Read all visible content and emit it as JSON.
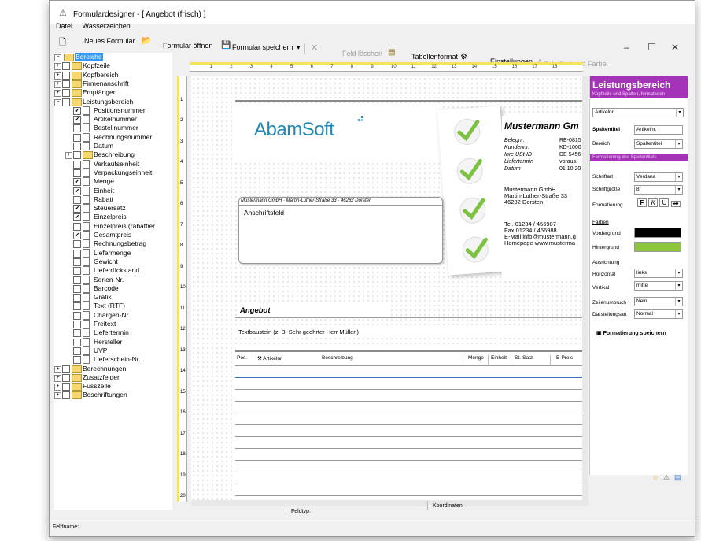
{
  "window": {
    "title": "Formulardesigner - [ Angebot (frisch) ]",
    "menu": [
      "Datei",
      "Wasserzeichen"
    ]
  },
  "toolbar": {
    "new_form": "Neues Formular",
    "open_form": "Formular öffnen",
    "save_form": "Formular speichern",
    "delete_field": "Feld löschen",
    "table_format": "Tabellenformat",
    "settings": "Einstellungen",
    "font_color": "Schriftart und Farbe"
  },
  "tree": {
    "root": "Bereiche",
    "top": [
      "Kopfzeile",
      "Kopfbereich",
      "Firmenanschrift",
      "Empfänger",
      "Leistungsbereich"
    ],
    "leistung": [
      {
        "label": "Positionsnummer",
        "checked": true
      },
      {
        "label": "Artikelnummer",
        "checked": true
      },
      {
        "label": "Bestellnummer",
        "checked": false
      },
      {
        "label": "Rechnungsnummer",
        "checked": false
      },
      {
        "label": "Datum",
        "checked": false
      },
      {
        "label": "Beschreibung",
        "checked": false
      },
      {
        "label": "Verkaufseinheit",
        "checked": false
      },
      {
        "label": "Verpackungseinheit",
        "checked": false
      },
      {
        "label": "Menge",
        "checked": true
      },
      {
        "label": "Einheit",
        "checked": true
      },
      {
        "label": "Rabatt",
        "checked": false
      },
      {
        "label": "Steuersatz",
        "checked": true
      },
      {
        "label": "Einzelpreis",
        "checked": true
      },
      {
        "label": "Einzelpreis (rabattier",
        "checked": false
      },
      {
        "label": "Gesamtpreis",
        "checked": true
      },
      {
        "label": "Rechnungsbetrag",
        "checked": false
      },
      {
        "label": "Liefermenge",
        "checked": false
      },
      {
        "label": "Gewicht",
        "checked": false
      },
      {
        "label": "Lieferrückstand",
        "checked": false
      },
      {
        "label": "Serien-Nr.",
        "checked": false
      },
      {
        "label": "Barcode",
        "checked": false
      },
      {
        "label": "Grafik",
        "checked": false
      },
      {
        "label": "Text (RTF)",
        "checked": false
      },
      {
        "label": "Chargen-Nr.",
        "checked": false
      },
      {
        "label": "Freitext",
        "checked": false
      },
      {
        "label": "Liefertermin",
        "checked": false
      },
      {
        "label": "Hersteller",
        "checked": false
      },
      {
        "label": "UVP",
        "checked": false
      },
      {
        "label": "Lieferschein-Nr.",
        "checked": false
      }
    ],
    "bottom": [
      "Berechnungen",
      "Zusatzfelder",
      "Fusszeile",
      "Beschriftungen"
    ]
  },
  "doc": {
    "logo": "AbamSoft",
    "company": "Mustermann Gm",
    "sender_line": "Mustermann GmbH · Martin-Luther-Straße 33 · 46282 Dorsten",
    "address_field": "Anschriftsfeld",
    "info_labels": [
      "Belegnr.",
      "Kundennr.",
      "Ihre USt-ID",
      "Liefertermin",
      "Datum"
    ],
    "info_values": [
      "RE-0815",
      "KD-1000",
      "DE 5456",
      "voraus.",
      "01.10.20"
    ],
    "company_address": [
      "Mustermann GmbH",
      "Martin-Luther-Straße 33",
      "46282 Dorsten"
    ],
    "contacts": [
      "Tel. 01234 / 456987",
      "Fax 01234 / 456988",
      "E-Mail info@mustermann.g",
      "Homepage www.musterma"
    ],
    "heading": "Angebot",
    "textbaustein": "Textbaustein (z. B. Sehr geehrter Herr Müller,)",
    "columns": [
      "Pos.",
      "Artikelnr.",
      "Beschreibung",
      "Menge",
      "Einheit",
      "St.-Satz",
      "E-Preis"
    ]
  },
  "panel": {
    "title": "Leistungsbereich",
    "subtitle": "Kopfzeile und Spalten, formatieren",
    "field_select": "Artikelnr.",
    "spaltentitel_label": "Spaltentitel",
    "spaltentitel_value": "Artikelnr.",
    "bereich_label": "Bereich",
    "bereich_value": "Spaltentitel",
    "section2": "Formatierung des Spaltentitels",
    "schriftart_label": "Schriftart",
    "schriftart_value": "Verdana",
    "schriftgroesse_label": "Schriftgröße",
    "schriftgroesse_value": "8",
    "formatierung_label": "Formatierung",
    "farben_label": "Farben",
    "vordergrund_label": "Vordergrund",
    "hintergrund_label": "Hintergrund",
    "fg_color": "#000000",
    "bg_color": "#8cc63f",
    "ausrichtung_label": "Ausrichtung",
    "horizontal_label": "Horizontal",
    "horizontal_value": "links",
    "vertikal_label": "Vertikal",
    "vertikal_value": "mitte",
    "zeilenumbruch_label": "Zeilenumbruch",
    "zeilenumbruch_value": "Nein",
    "darstellungsart_label": "Darstellungsart",
    "darstellungsart_value": "Normal",
    "save_label": "Formatierung speichern"
  },
  "status": {
    "feldtyp": "Feldtyp:",
    "koordinaten": "Koordinaten:",
    "feldname": "Feldname:"
  },
  "accent": "#a533b8",
  "check_color": "#7cc142"
}
